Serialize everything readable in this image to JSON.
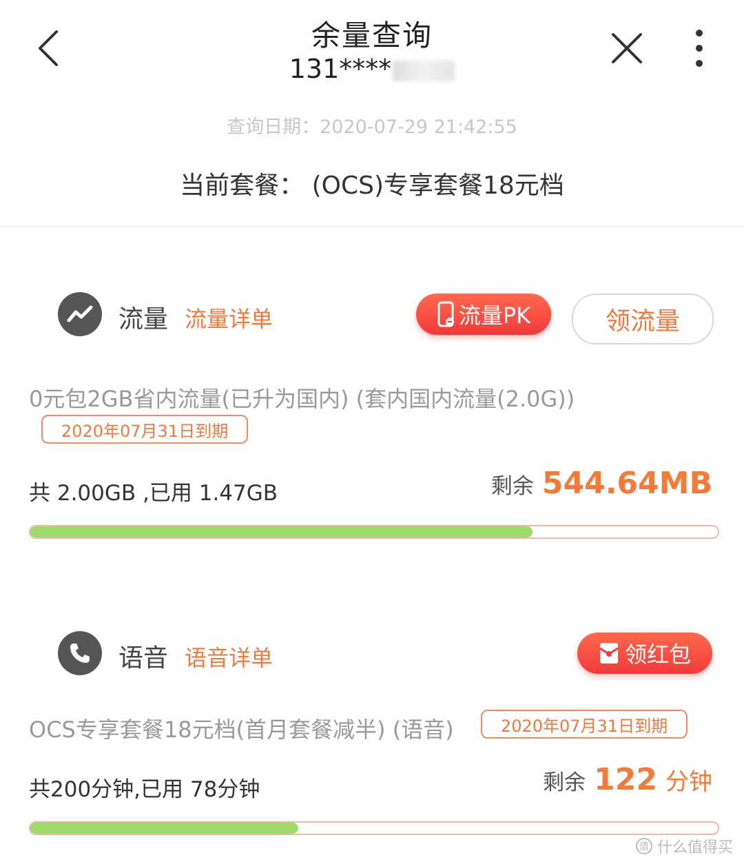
{
  "header": {
    "title": "余量查询",
    "phone_prefix": "131****",
    "query_date": "查询日期：2020-07-29 21:42:55",
    "plan": "当前套餐：  (OCS)专享套餐18元档"
  },
  "data_section": {
    "title": "流量",
    "detail_link": "流量详单",
    "pk_button": "流量PK",
    "get_button": "领流量",
    "package_name": "0元包2GB省内流量(已升为国内) (套内国内流量(2.0G))",
    "expire": "2020年07月31日到期",
    "usage": "共 2.00GB ,已用 1.47GB",
    "remain_label": "剩余",
    "remain_value": "544.64MB",
    "progress_percent": 73
  },
  "voice_section": {
    "title": "语音",
    "detail_link": "语音详单",
    "redpack_button": "领红包",
    "package_name": "OCS专享套餐18元档(首月套餐减半) (语音)",
    "expire": "2020年07月31日到期",
    "usage": "共200分钟,已用 78分钟",
    "remain_label": "剩余",
    "remain_value": "122",
    "remain_unit": "分钟",
    "progress_percent": 39
  },
  "watermark": "什么值得买",
  "colors": {
    "accent": "#f07a3c",
    "button_red": "#f2393a",
    "progress_green": "#9edb6a"
  }
}
